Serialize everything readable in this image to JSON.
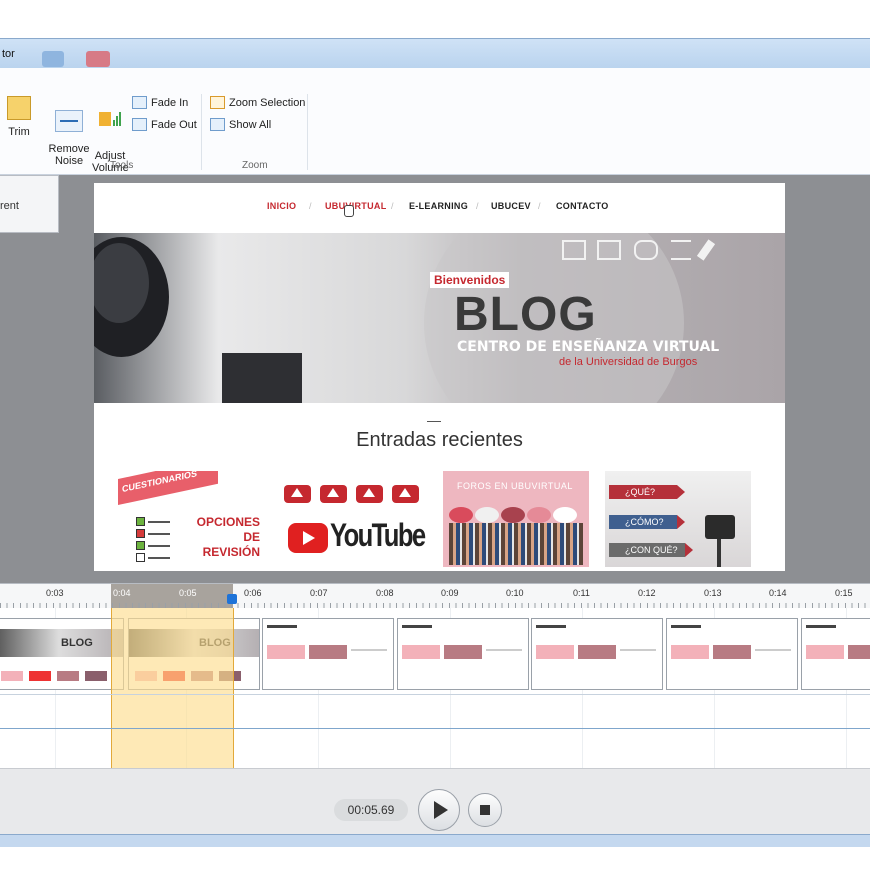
{
  "window": {
    "title_fragment": "tor"
  },
  "ribbon": {
    "trim_label": "Trim",
    "remove_noise_label": "Remove\nNoise",
    "adjust_volume_label": "Adjust\nVolume",
    "fade_in_label": "Fade In",
    "fade_out_label": "Fade Out",
    "zoom_selection_label": "Zoom Selection",
    "show_all_label": "Show All",
    "group_tools": "Tools",
    "group_zoom": "Zoom"
  },
  "left_panel": {
    "label": "rent"
  },
  "preview": {
    "nav": [
      "INICIO",
      "UBUVIRTUAL",
      "E-LEARNING",
      "UBUCEV",
      "CONTACTO"
    ],
    "bienvenidos": "Bienvenidos",
    "blog": "BLOG",
    "centro": "CENTRO DE ENSEÑANZA VIRTUAL",
    "universidad": "de la Universidad de Burgos",
    "entradas": "Entradas recientes",
    "thumb1_banner": "CUESTIONARIOS",
    "thumb1_text": [
      "OPCIONES",
      "DE",
      "REVISIÓN"
    ],
    "thumb2_text": "YouTube",
    "thumb3_label": "FOROS EN UBUVIRTUAL",
    "thumb4_labels": [
      "¿QUÉ?",
      "¿CÓMO?",
      "¿CON QUÉ?"
    ]
  },
  "timeline": {
    "ticks": [
      "0:03",
      "0:04",
      "0:05",
      "0:06",
      "0:07",
      "0:08",
      "0:09",
      "0:10",
      "0:11",
      "0:12",
      "0:13",
      "0:14",
      "0:15"
    ]
  },
  "transport": {
    "time": "00:05.69"
  },
  "colors": {
    "accent_red": "#c5282f",
    "selection": "#fddd8f",
    "playhead": "#1e73d8"
  }
}
